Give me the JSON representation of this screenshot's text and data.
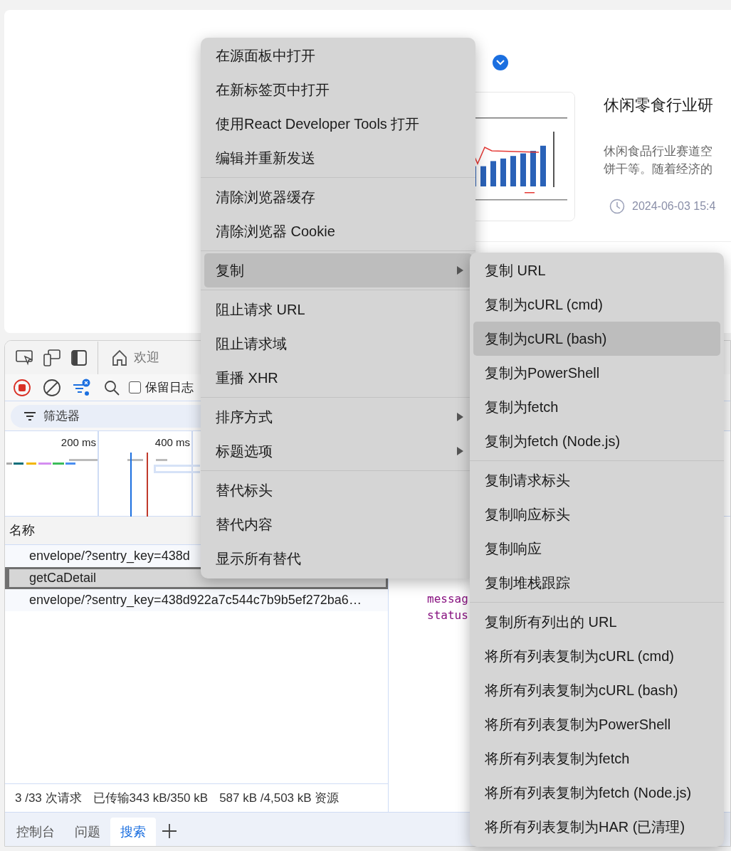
{
  "article": {
    "title": "休闲零食行业研",
    "description_lines": [
      "休闲食品行业赛道空",
      "饼干等。随着经济的"
    ],
    "date": "2024-06-03 15:4",
    "thumbnail": {
      "kind": "picture"
    }
  },
  "devtools": {
    "top_tabs": [
      {
        "label": "欢迎",
        "selected": false
      }
    ],
    "preserve_log": {
      "label": "保留日志",
      "checked": false
    },
    "filter": {
      "placeholder": "筛选器"
    },
    "overview_ticks": [
      "200 ms",
      "400 ms"
    ],
    "table": {
      "column": "名称",
      "rows": [
        {
          "name": "envelope/?sentry_key=438d",
          "selected": false
        },
        {
          "name": "getCaDetail",
          "selected": true
        },
        {
          "name": "envelope/?sentry_key=438d922a7c544c7b9b5ef272ba6…",
          "selected": false
        }
      ]
    },
    "status_bar": [
      "3 /33 次请求",
      "已传输343 kB/350 kB",
      "587 kB /4,503 kB 资源"
    ],
    "response_preview": [
      "messag",
      "status"
    ],
    "drawer_tabs": [
      {
        "label": "控制台",
        "selected": false
      },
      {
        "label": "问题",
        "selected": false
      },
      {
        "label": "搜索",
        "selected": true
      }
    ]
  },
  "context_menu": {
    "groups": [
      {
        "items": [
          {
            "label": "在源面板中打开",
            "selected": false,
            "submenu": false
          },
          {
            "label": "在新标签页中打开",
            "selected": false,
            "submenu": false
          },
          {
            "label": "使用React Developer Tools 打开",
            "selected": false,
            "submenu": false
          },
          {
            "label": "编辑并重新发送",
            "selected": false,
            "submenu": false
          }
        ]
      },
      {
        "items": [
          {
            "label": "清除浏览器缓存",
            "selected": false,
            "submenu": false
          },
          {
            "label": "清除浏览器 Cookie",
            "selected": false,
            "submenu": false
          }
        ]
      },
      {
        "items": [
          {
            "label": "复制",
            "selected": true,
            "submenu": true
          }
        ]
      },
      {
        "items": [
          {
            "label": "阻止请求 URL",
            "selected": false,
            "submenu": false
          },
          {
            "label": "阻止请求域",
            "selected": false,
            "submenu": false
          },
          {
            "label": "重播 XHR",
            "selected": false,
            "submenu": false
          }
        ]
      },
      {
        "items": [
          {
            "label": "排序方式",
            "selected": false,
            "submenu": true
          },
          {
            "label": "标题选项",
            "selected": false,
            "submenu": true
          }
        ]
      },
      {
        "items": [
          {
            "label": "替代标头",
            "selected": false,
            "submenu": false
          },
          {
            "label": "替代内容",
            "selected": false,
            "submenu": false
          },
          {
            "label": "显示所有替代",
            "selected": false,
            "submenu": false
          }
        ]
      }
    ]
  },
  "copy_submenu": {
    "groups": [
      {
        "items": [
          {
            "label": "复制 URL",
            "selected": false,
            "submenu": false
          },
          {
            "label": "复制为cURL (cmd)",
            "selected": false,
            "submenu": false
          },
          {
            "label": "复制为cURL (bash)",
            "selected": true,
            "submenu": false
          },
          {
            "label": "复制为PowerShell",
            "selected": false,
            "submenu": false
          },
          {
            "label": "复制为fetch",
            "selected": false,
            "submenu": false
          },
          {
            "label": "复制为fetch (Node.js)",
            "selected": false,
            "submenu": false
          }
        ]
      },
      {
        "items": [
          {
            "label": "复制请求标头",
            "selected": false,
            "submenu": false
          },
          {
            "label": "复制响应标头",
            "selected": false,
            "submenu": false
          },
          {
            "label": "复制响应",
            "selected": false,
            "submenu": false
          },
          {
            "label": "复制堆栈跟踪",
            "selected": false,
            "submenu": false
          }
        ]
      },
      {
        "items": [
          {
            "label": "复制所有列出的 URL",
            "selected": false,
            "submenu": false
          },
          {
            "label": "将所有列表复制为cURL (cmd)",
            "selected": false,
            "submenu": false
          },
          {
            "label": "将所有列表复制为cURL (bash)",
            "selected": false,
            "submenu": false
          },
          {
            "label": "将所有列表复制为PowerShell",
            "selected": false,
            "submenu": false
          },
          {
            "label": "将所有列表复制为fetch",
            "selected": false,
            "submenu": false
          },
          {
            "label": "将所有列表复制为fetch (Node.js)",
            "selected": false,
            "submenu": false
          },
          {
            "label": "将所有列表复制为HAR (已清理)",
            "selected": false,
            "submenu": false
          }
        ]
      }
    ]
  }
}
